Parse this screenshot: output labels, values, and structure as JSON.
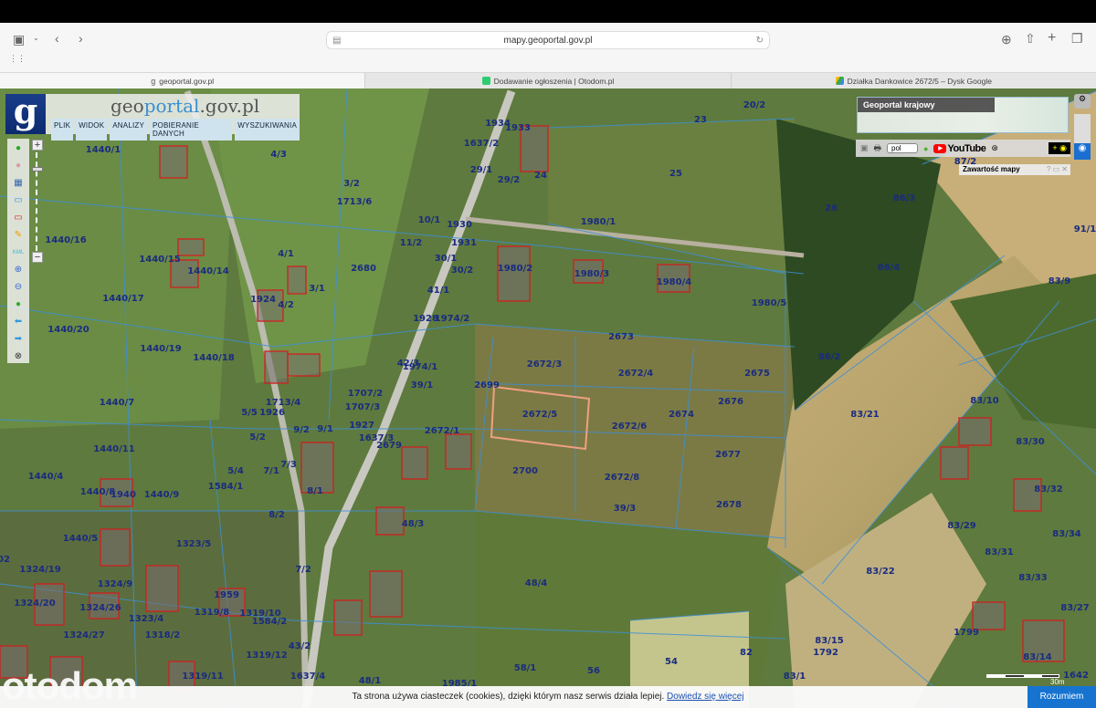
{
  "browser": {
    "url": "mapy.geoportal.gov.pl",
    "tabs": [
      {
        "label": "geoportal.gov.pl"
      },
      {
        "label": "Dodawanie ogłoszenia | Otodom.pl"
      },
      {
        "label": "Działka Dankowice 2672/5 – Dysk Google"
      }
    ]
  },
  "geoportal": {
    "logo": "g",
    "title_a": "geo",
    "title_b": "portal",
    "title_c": ".gov.pl",
    "menu": [
      "PLIK",
      "WIDOK",
      "ANALIZY",
      "POBIERANIE DANYCH",
      "WYSZUKIWANIA"
    ],
    "minimap_label": "Geoportal krajowy",
    "lang": "pol",
    "youtube": "YouTube",
    "eye": "+ ◉",
    "layers_panel": "Zawartość mapy",
    "layers_panel_ctrls": "? ▭ ✕",
    "scale": "30m",
    "zoom_in": "+",
    "zoom_out": "−"
  },
  "map": {
    "selected_parcel": "2672/5",
    "selected_color": "#f0a080",
    "parcels": [
      "1440/1",
      "4/3",
      "3/2",
      "1713/6",
      "10/1",
      "11/2",
      "1440/16",
      "1440/15",
      "1440/14",
      "4/1",
      "1924",
      "4/2",
      "3/1",
      "2680",
      "30/1",
      "30/2",
      "41/1",
      "1928",
      "1974/2",
      "1931",
      "1930",
      "1440/17",
      "1440/20",
      "1440/19",
      "1440/18",
      "1440/7",
      "1713/4",
      "1926",
      "5/5",
      "1707/2",
      "1707/3",
      "42/3",
      "1974/1",
      "39/1",
      "1934",
      "1933",
      "1637/2",
      "29/1",
      "29/2",
      "24",
      "23",
      "20/2",
      "25",
      "26",
      "1980/1",
      "1980/2",
      "1980/3",
      "1980/4",
      "1980/5",
      "2673",
      "2672/3",
      "2672/4",
      "2675",
      "2676",
      "2674",
      "2699",
      "2672/5",
      "2672/6",
      "2672/1",
      "2677",
      "2679",
      "1637/3",
      "1927",
      "9/1",
      "9/2",
      "5/2",
      "2700",
      "2672/8",
      "2678",
      "39/3",
      "1440/11",
      "1440/4",
      "1440/8",
      "1940",
      "1440/9",
      "1584/1",
      "5/4",
      "7/1",
      "7/3",
      "8/1",
      "8/2",
      "48/3",
      "1440/5",
      "1323/5",
      "1324/19",
      "1324/9",
      "7/2",
      "48/4",
      "1324/20",
      "1324/26",
      "1323/4",
      "1319/8",
      "1959",
      "1319/10",
      "1584/2",
      "1318/2",
      "1324/27",
      "43/2",
      "1319/12",
      "1319/11",
      "1637/4",
      "48/1",
      "58/1",
      "56",
      "54",
      "82",
      "83/15",
      "1792",
      "83/1",
      "1985/1",
      "1799",
      "83/14",
      "83/27",
      "83/33",
      "83/31",
      "83/29",
      "83/34",
      "83/32",
      "83/30",
      "83/10",
      "83/21",
      "83/22",
      "86/2",
      "86/4",
      "86/3",
      "87/2",
      "91/1",
      "83/9",
      "1642",
      "02"
    ]
  },
  "watermark": "otodom",
  "cookie": {
    "text": "Ta strona używa ciasteczek (cookies), dzięki którym nasz serwis działa lepiej. ",
    "link": "Dowiedz się więcej",
    "button": "Rozumiem"
  }
}
